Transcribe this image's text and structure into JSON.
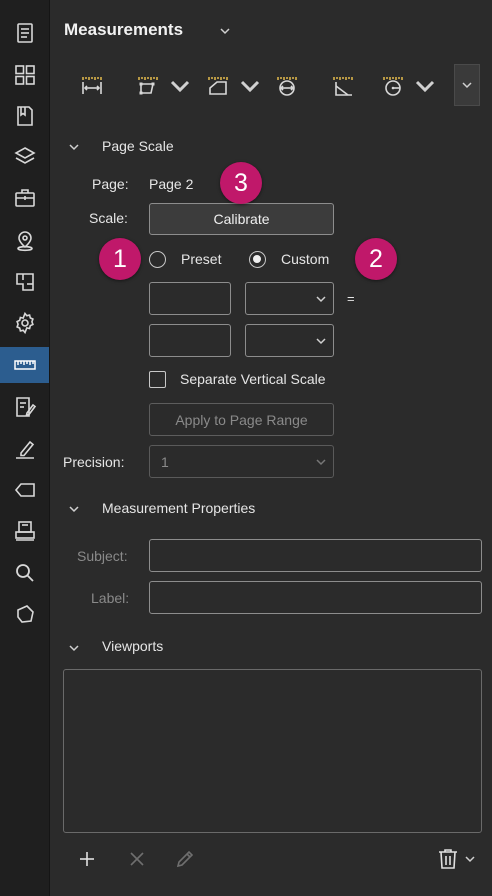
{
  "panel": {
    "title": "Measurements"
  },
  "rail": {
    "items": [
      {
        "icon": "bookmarks-panel-icon"
      },
      {
        "icon": "thumbnails-icon"
      },
      {
        "icon": "book-icon"
      },
      {
        "icon": "layers-icon"
      },
      {
        "icon": "toolbox-icon"
      },
      {
        "icon": "location-pin-icon"
      },
      {
        "icon": "spaces-icon"
      },
      {
        "icon": "settings-gear-icon"
      },
      {
        "icon": "ruler-icon",
        "active": true
      },
      {
        "icon": "markups-list-icon"
      },
      {
        "icon": "signatures-pen-icon"
      },
      {
        "icon": "tag-icon"
      },
      {
        "icon": "printer-stack-icon"
      },
      {
        "icon": "search-icon"
      },
      {
        "icon": "shape-icon"
      }
    ]
  },
  "page_scale": {
    "heading": "Page Scale",
    "page_label": "Page:",
    "page_value": "Page 2",
    "scale_label": "Scale:",
    "calibrate_label": "Calibrate",
    "preset_label": "Preset",
    "custom_label": "Custom",
    "custom_selected": true,
    "equals": "=",
    "separate_vertical_label": "Separate Vertical Scale",
    "separate_vertical_checked": false,
    "apply_label": "Apply to Page Range",
    "precision_label": "Precision:",
    "precision_value": "1"
  },
  "measurement_properties": {
    "heading": "Measurement Properties",
    "subject_label": "Subject:",
    "label_label": "Label:"
  },
  "viewports": {
    "heading": "Viewports"
  },
  "callouts": {
    "one": "1",
    "two": "2",
    "three": "3",
    "color": "#c0186a"
  },
  "colors": {
    "background": "#2b2b2b",
    "rail": "#1f1f1f",
    "active": "#2c5d8f",
    "accent_icon": "#d9b24a"
  }
}
